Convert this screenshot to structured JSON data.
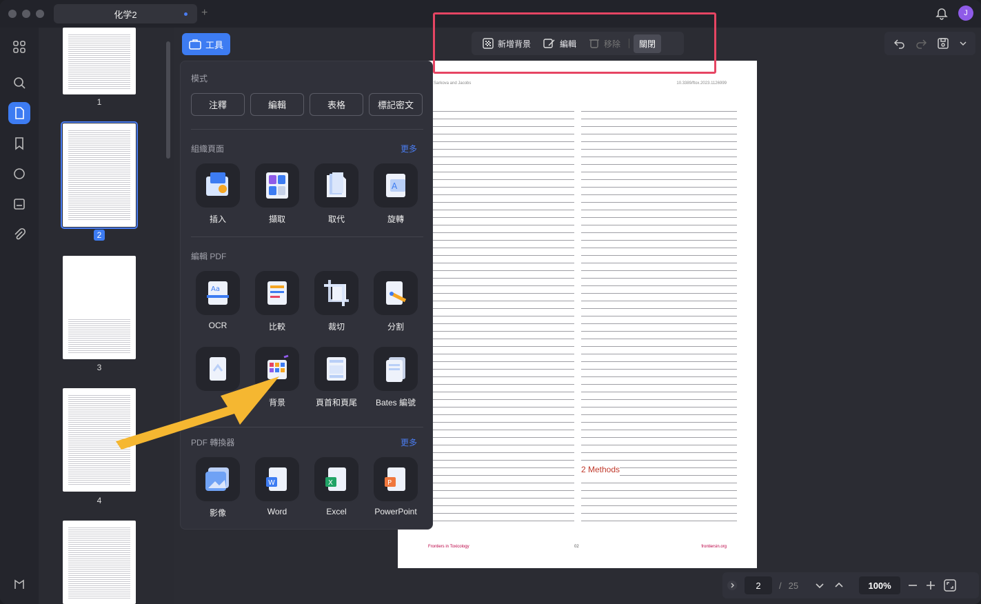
{
  "window": {
    "tab_title": "化学2",
    "add_tab": "+",
    "avatar_initial": "J"
  },
  "toolbar": {
    "tool_label": "工具",
    "add_background": "新增背景",
    "edit": "編輯",
    "remove": "移除",
    "close": "關閉"
  },
  "panel": {
    "mode_title": "模式",
    "modes": [
      "注釋",
      "編輯",
      "表格",
      "標記密文"
    ],
    "organize_title": "組織頁面",
    "organize_more": "更多",
    "organize": [
      "插入",
      "擷取",
      "取代",
      "旋轉"
    ],
    "edit_title": "編輯 PDF",
    "edit_row1": [
      "OCR",
      "比較",
      "裁切",
      "分割"
    ],
    "edit_row2": [
      "",
      "背景",
      "頁首和頁尾",
      "Bates 編號"
    ],
    "convert_title": "PDF 轉換器",
    "convert_more": "更多",
    "convert": [
      "影像",
      "Word",
      "Excel",
      "PowerPoint"
    ]
  },
  "thumbnails": [
    "1",
    "2",
    "3",
    "4"
  ],
  "page": {
    "header_left": "Sarkova and Jacobs",
    "header_right": "10.3389/ftox.2023.1126999",
    "section_heading": "2 Methods",
    "footer_left": "Frontiers in Toxicology",
    "footer_center": "02",
    "footer_right": "frontiersin.org"
  },
  "nav": {
    "current_page": "2",
    "separator": "/",
    "total_pages": "25",
    "zoom": "100%"
  },
  "colors": {
    "accent": "#3d7cf2",
    "highlight_box": "#e64563",
    "arrow": "#f5b731"
  }
}
